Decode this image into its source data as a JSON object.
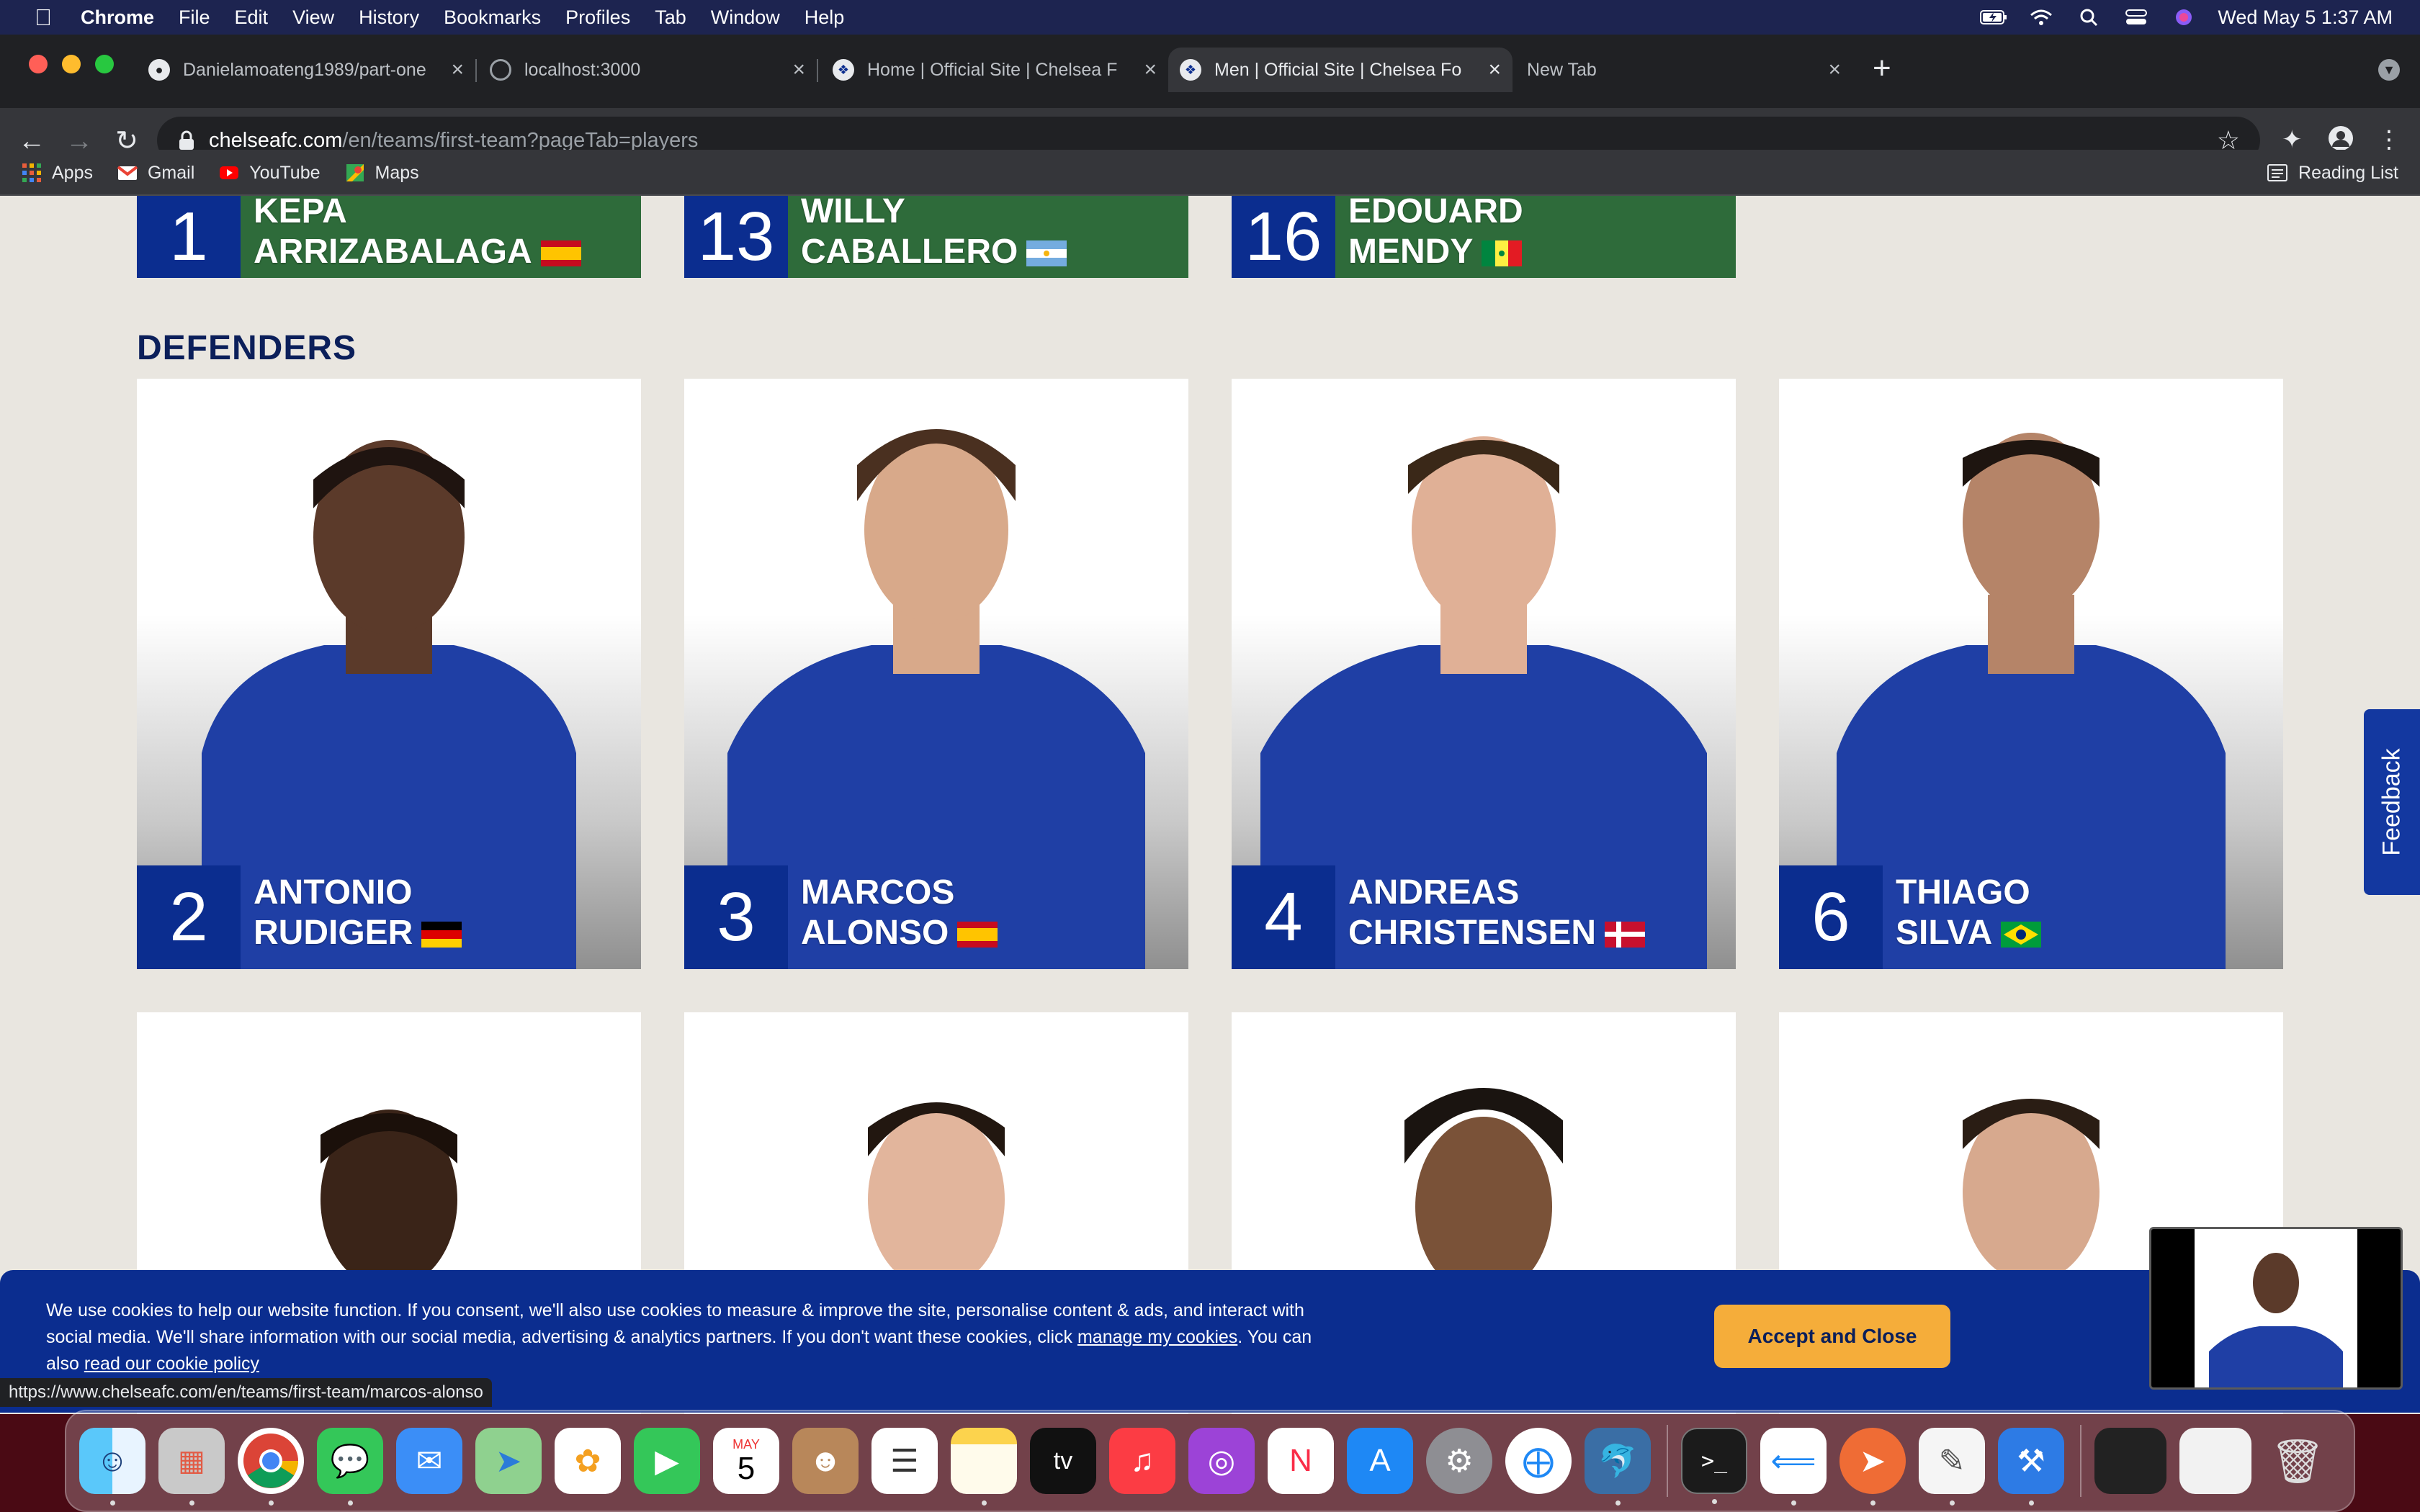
{
  "menubar": {
    "app": "Chrome",
    "items": [
      "File",
      "Edit",
      "View",
      "History",
      "Bookmarks",
      "Profiles",
      "Tab",
      "Window",
      "Help"
    ],
    "clock": "Wed May 5  1:37 AM"
  },
  "tabs": [
    {
      "title": "Danielamoateng1989/part-one",
      "icon": "github-icon"
    },
    {
      "title": "localhost:3000",
      "icon": "globe-icon"
    },
    {
      "title": "Home | Official Site | Chelsea F",
      "icon": "chelsea-icon"
    },
    {
      "title": "Men | Official Site | Chelsea Fo",
      "icon": "chelsea-icon"
    },
    {
      "title": "New Tab",
      "icon": ""
    }
  ],
  "address": {
    "host": "chelseafc.com",
    "path": "/en/teams/first-team?pageTab=players"
  },
  "bookmarks": {
    "items": [
      "Apps",
      "Gmail",
      "YouTube",
      "Maps"
    ],
    "reading_list": "Reading List"
  },
  "goalkeepers": [
    {
      "number": "1",
      "first": "KEPA",
      "last": "ARRIZABALAGA",
      "flag": "spain"
    },
    {
      "number": "13",
      "first": "WILLY",
      "last": "CABALLERO",
      "flag": "argentina"
    },
    {
      "number": "16",
      "first": "EDOUARD",
      "last": "MENDY",
      "flag": "senegal"
    }
  ],
  "section_title": "DEFENDERS",
  "defenders": [
    {
      "number": "2",
      "first": "ANTONIO",
      "last": "RUDIGER",
      "flag": "germany"
    },
    {
      "number": "3",
      "first": "MARCOS",
      "last": "ALONSO",
      "flag": "spain"
    },
    {
      "number": "4",
      "first": "ANDREAS",
      "last": "CHRISTENSEN",
      "flag": "denmark"
    },
    {
      "number": "6",
      "first": "THIAGO",
      "last": "SILVA",
      "flag": "brazil"
    }
  ],
  "feedback_label": "Feedback",
  "cookie": {
    "text_1": "We use cookies to help our website function. If you consent, we'll also use cookies to measure & improve the site, personalise content & ads, and interact with social media. We'll share information with our social media, advertising & analytics partners. If you don't want these cookies, click ",
    "link_1": "manage my cookies",
    "text_2": ". You can also ",
    "link_2": "read our cookie policy",
    "accept_label": "Accept and Close"
  },
  "status_url": "https://www.chelseafc.com/en/teams/first-team/marcos-alonso",
  "dock_calendar": {
    "month": "MAY",
    "day": "5"
  },
  "dock_apps": [
    "finder",
    "launchpad",
    "chrome",
    "messages",
    "mail",
    "maps",
    "photos",
    "facetime",
    "calendar",
    "contacts",
    "reminders",
    "notes",
    "apple-tv",
    "music",
    "podcasts",
    "news",
    "app-store",
    "system-preferences",
    "safari",
    "mysql-workbench",
    "terminal",
    "vscode",
    "postman",
    "textedit",
    "xcode",
    "trash"
  ]
}
